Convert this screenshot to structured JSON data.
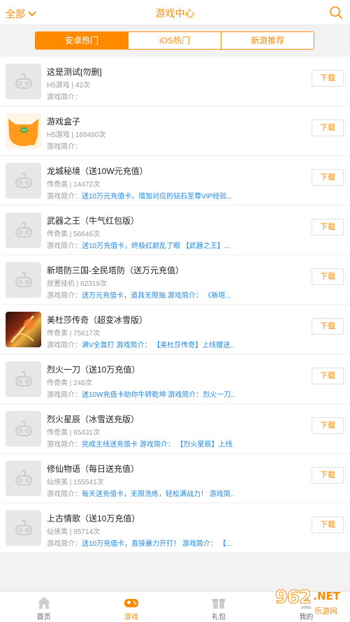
{
  "header": {
    "filter_label": "全部",
    "title": "游戏中心"
  },
  "tabs": [
    {
      "label": "安卓热门",
      "active": true
    },
    {
      "label": "iOS热门",
      "active": false
    },
    {
      "label": "新游推荐",
      "active": false
    }
  ],
  "games": [
    {
      "name": "这是测试[勿删]",
      "meta": "H5游戏 | 42次",
      "desc_label": "游戏简介：",
      "desc_text": "",
      "icon": "gamepad-placeholder"
    },
    {
      "name": "游戏盒子",
      "meta": "H5游戏 | 169490次",
      "desc_label": "游戏简介：",
      "desc_text": "",
      "icon": "cat-logo"
    },
    {
      "name": "龙城秘境（送10W元充值）",
      "meta": "传奇类 | 14472次",
      "desc_label": "游戏简介：",
      "desc_text": "送10万元充值卡，增加对应的钻石至尊VIP经验...",
      "icon": "gamepad-placeholder"
    },
    {
      "name": "武器之王（牛气红包版）",
      "meta": "传奇类 | 56646次",
      "desc_label": "游戏简介：",
      "desc_text": "送10万充值卡，终极红颜乱了眼 【武器之王】...",
      "icon": "gamepad-placeholder"
    },
    {
      "name": "新塔防三国-全民塔防（送万元充值）",
      "meta": "放置挂机 | 62319次",
      "desc_label": "游戏简介：",
      "desc_text": "送万元充值卡，道具无限抽 游戏简介： 《新塔...",
      "icon": "gamepad-placeholder"
    },
    {
      "name": "美杜莎传奇（超变冰雪版）",
      "meta": "传奇类 | 75617次",
      "desc_label": "游戏简介：",
      "desc_text": "满V全靠打 游戏简介： 【美杜莎传奇】上线赠送...",
      "icon": "game-art"
    },
    {
      "name": "烈火一刀（送10万充值）",
      "meta": "传奇类 | 248次",
      "desc_label": "游戏简介：",
      "desc_text": "送10W充值卡助你牛转乾坤 游戏简介：烈火一刀...",
      "icon": "gamepad-placeholder"
    },
    {
      "name": "烈火星辰（冰雪送充版）",
      "meta": "传奇类 | 65431次",
      "desc_label": "游戏简介：",
      "desc_text": "完成主线送充值卡 游戏简介： 【烈火星辰】上线...",
      "icon": "gamepad-placeholder"
    },
    {
      "name": "修仙物语（每日送充值）",
      "meta": "仙侠类 | 155541次",
      "desc_label": "游戏简介：",
      "desc_text": "每天送充值卡，无限洗练，轻松满战力！ 游戏简...",
      "icon": "gamepad-placeholder"
    },
    {
      "name": "上古情歌（送10万充值）",
      "meta": "仙侠类 | 95714次",
      "desc_label": "游戏简介：",
      "desc_text": "送10万充值卡，直接暴力开打！ 游戏简介： 【...",
      "icon": "gamepad-placeholder"
    }
  ],
  "download_label": "下载",
  "bottom_nav": [
    {
      "label": "首页",
      "icon": "home-icon",
      "active": false
    },
    {
      "label": "游戏",
      "icon": "gamepad-icon",
      "active": true
    },
    {
      "label": "礼包",
      "icon": "gift-icon",
      "active": false
    },
    {
      "label": "我的",
      "icon": "user-icon",
      "active": false
    }
  ],
  "watermark": {
    "number": "962",
    "suffix": ".NET",
    "subtitle": "乐游网"
  },
  "colors": {
    "accent": "#ff8a00",
    "link": "#1e88e5",
    "muted": "#999999"
  }
}
